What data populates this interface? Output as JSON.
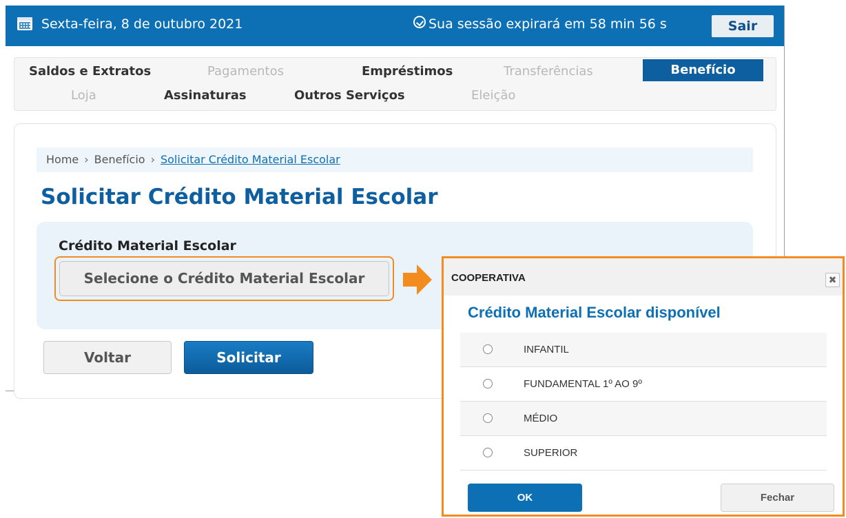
{
  "topbar": {
    "date": "Sexta-feira, 8 de outubro 2021",
    "session": "Sua sessão expirará em 58 min 56 s",
    "logout": "Sair"
  },
  "nav": {
    "row1": [
      {
        "label": "Saldos e Extratos",
        "state": "enabled"
      },
      {
        "label": "Pagamentos",
        "state": "disabled"
      },
      {
        "label": "Empréstimos",
        "state": "enabled"
      },
      {
        "label": "Transferências",
        "state": "disabled"
      },
      {
        "label": "Benefício",
        "state": "active"
      }
    ],
    "row2": [
      {
        "label": "Loja",
        "state": "disabled"
      },
      {
        "label": "Assinaturas",
        "state": "enabled"
      },
      {
        "label": "Outros Serviços",
        "state": "enabled"
      },
      {
        "label": "Eleição",
        "state": "disabled"
      }
    ]
  },
  "breadcrumb": {
    "items": [
      "Home",
      "Benefício"
    ],
    "current": "Solicitar Crédito Material Escolar"
  },
  "page": {
    "title": "Solicitar Crédito Material Escolar",
    "field_label": "Crédito Material Escolar",
    "select_placeholder": "Selecione o Crédito Material Escolar",
    "back": "Voltar",
    "submit": "Solicitar"
  },
  "modal": {
    "header": "COOPERATIVA",
    "close_glyph": "✖",
    "title": "Crédito Material Escolar disponível",
    "options": [
      "INFANTIL",
      "FUNDAMENTAL 1º AO 9º",
      "MÉDIO",
      "SUPERIOR"
    ],
    "ok": "OK",
    "close": "Fechar"
  },
  "colors": {
    "primary": "#0d70b5",
    "highlight": "#f28c1e"
  },
  "icons": [
    "calendar-icon",
    "clock-icon",
    "arrow-right-icon",
    "close-icon"
  ]
}
